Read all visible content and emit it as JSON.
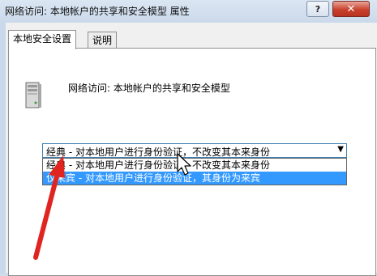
{
  "window": {
    "title": "网络访问: 本地帐户的共享和安全模型 属性",
    "help_glyph": "?",
    "close_glyph": "✕"
  },
  "tabs": [
    {
      "label": "本地安全设置",
      "active": true
    },
    {
      "label": "说明",
      "active": false
    }
  ],
  "policy": {
    "name": "网络访问: 本地帐户的共享和安全模型",
    "icon": "server-icon"
  },
  "combo": {
    "selected": "经典 - 对本地用户进行身份验证，不改变其本来身份",
    "arrow_glyph": "▼"
  },
  "options": [
    {
      "label": "经典 - 对本地用户进行身份验证，不改变其本来身份",
      "highlighted": false
    },
    {
      "label": "仅来宾 - 对本地用户进行身份验证，其身份为来宾",
      "highlighted": true
    }
  ],
  "annotation": {
    "arrow_color": "#e0241f"
  },
  "colors": {
    "selection": "#3399ff",
    "close_button": "#c8412d"
  }
}
